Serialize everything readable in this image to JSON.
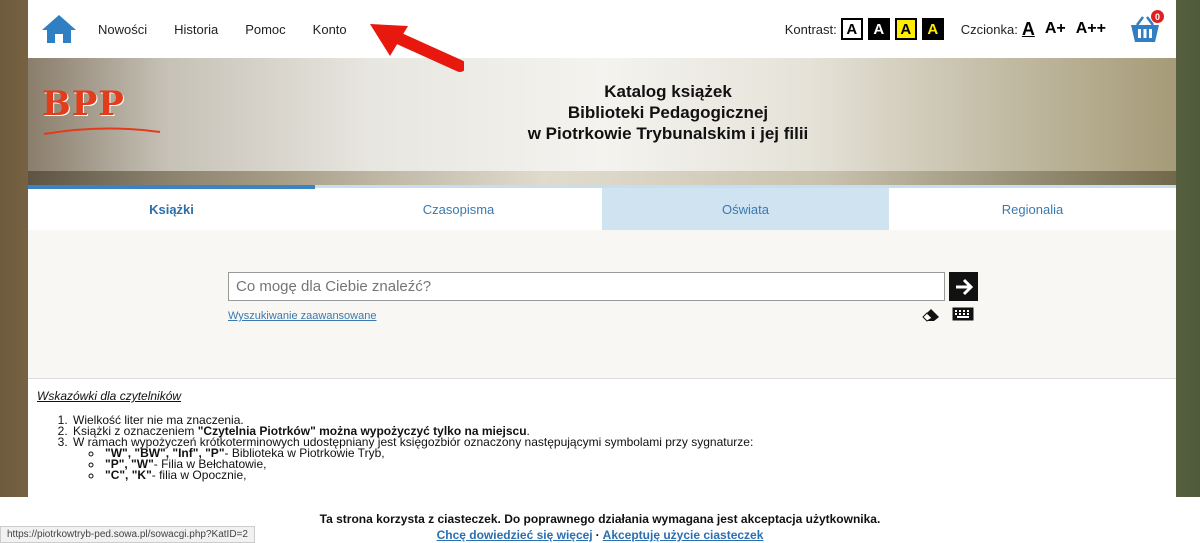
{
  "nav": {
    "home_icon": "home-icon",
    "items": [
      "Nowości",
      "Historia",
      "Pomoc",
      "Konto"
    ]
  },
  "accessibility": {
    "contrast_label": "Kontrast:",
    "contrast_buttons": [
      "A",
      "A",
      "A",
      "A"
    ],
    "font_label": "Czcionka:",
    "font_buttons": [
      "A",
      "A+",
      "A++"
    ]
  },
  "basket": {
    "icon": "basket-icon",
    "count": "0"
  },
  "banner": {
    "logo_text": "BPP",
    "title_lines": [
      "Katalog książek",
      "Biblioteki Pedagogicznej",
      "w Piotrkowie Trybunalskim i jej filii"
    ]
  },
  "tabs": [
    "Książki",
    "Czasopisma",
    "Oświata",
    "Regionalia"
  ],
  "search": {
    "placeholder": "Co mogę dla Ciebie znaleźć?",
    "advanced_link": "Wyszukiwanie zaawansowane"
  },
  "hints": {
    "title": "Wskazówki dla czytelników",
    "item1": "Wielkość liter nie ma znaczenia.",
    "item2_prefix": "Książki z oznaczeniem ",
    "item2_bold": "\"Czytelnia Piotrków\" można wypożyczyć tylko na miejscu",
    "item2_suffix": ".",
    "item3": "W ramach wypożyczeń krótkoterminowych udostępniany jest księgozbiór oznaczony następującymi symbolami przy sygnaturze:",
    "sub": [
      {
        "symbols": "\"W\", \"BW\", \"Inf\", \"P\"",
        "text": "- Biblioteka w Piotrkowie Tryb,"
      },
      {
        "symbols": "\"P\", \"W\"",
        "text": "- Filia w Bełchatowie,"
      },
      {
        "symbols": "\"C\", \"K\"",
        "text": "- filia w Opocznie,"
      }
    ]
  },
  "cookie": {
    "message": "Ta strona korzysta z ciasteczek. Do poprawnego działania wymagana jest akceptacja użytkownika.",
    "learn_more": "Chcę dowiedzieć się więcej",
    "separator": "·",
    "accept": "Akceptuję użycie ciasteczek"
  },
  "status_url": "https://piotrkowtryb-ped.sowa.pl/sowacgi.php?KatID=2",
  "colors": {
    "accent": "#3a84c3",
    "arrow": "#e8180e",
    "logo": "#e43b1a"
  }
}
